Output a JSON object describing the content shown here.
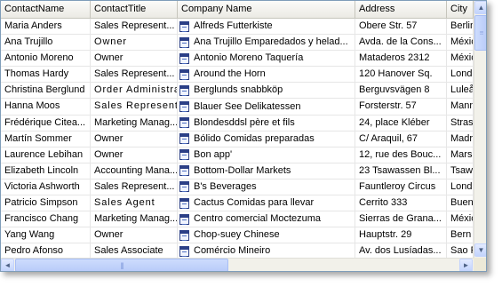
{
  "columns": [
    "ContactName",
    "ContactTitle",
    "Company Name",
    "Address",
    "City"
  ],
  "rows": [
    {
      "name": "Maria Anders",
      "title": "Sales Represent...",
      "company": "Alfreds Futterkiste",
      "address": "Obere Str. 57",
      "city": "Berlin"
    },
    {
      "name": "Ana Trujillo",
      "title": "Owner",
      "company": "Ana Trujillo Emparedados y helad...",
      "address": "Avda. de la Cons...",
      "city": "México"
    },
    {
      "name": "Antonio Moreno",
      "title": "Owner",
      "company": "Antonio Moreno Taquería",
      "address": "Mataderos 2312",
      "city": "México"
    },
    {
      "name": "Thomas Hardy",
      "title": "Sales Represent...",
      "company": "Around the Horn",
      "address": "120 Hanover Sq.",
      "city": "London"
    },
    {
      "name": "Christina Berglund",
      "title": "Order Administra...",
      "company": "Berglunds snabbköp",
      "address": "Berguvsvägen 8",
      "city": "Luleå"
    },
    {
      "name": "Hanna Moos",
      "title": "Sales Represent...",
      "company": "Blauer See Delikatessen",
      "address": "Forsterstr. 57",
      "city": "Mannheim"
    },
    {
      "name": "Frédérique Citea...",
      "title": "Marketing Manag...",
      "company": "Blondesddsl père et fils",
      "address": "24, place Kléber",
      "city": "Strasbourg"
    },
    {
      "name": "Martín Sommer",
      "title": "Owner",
      "company": "Bólido Comidas preparadas",
      "address": "C/ Araquil, 67",
      "city": "Madrid"
    },
    {
      "name": "Laurence Lebihan",
      "title": "Owner",
      "company": "Bon app'",
      "address": "12, rue des Bouc...",
      "city": "Marseille"
    },
    {
      "name": "Elizabeth Lincoln",
      "title": "Accounting Mana...",
      "company": "Bottom-Dollar Markets",
      "address": "23 Tsawassen Bl...",
      "city": "Tsawassen"
    },
    {
      "name": "Victoria Ashworth",
      "title": "Sales Represent...",
      "company": "B's Beverages",
      "address": "Fauntleroy Circus",
      "city": "London"
    },
    {
      "name": "Patricio Simpson",
      "title": "Sales Agent",
      "company": "Cactus Comidas para llevar",
      "address": "Cerrito 333",
      "city": "Buenos Aires"
    },
    {
      "name": "Francisco Chang",
      "title": "Marketing Manag...",
      "company": "Centro comercial Moctezuma",
      "address": "Sierras de Grana...",
      "city": "México"
    },
    {
      "name": "Yang Wang",
      "title": "Owner",
      "company": "Chop-suey Chinese",
      "address": "Hauptstr. 29",
      "city": "Bern"
    },
    {
      "name": "Pedro Afonso",
      "title": "Sales Associate",
      "company": "Comércio Mineiro",
      "address": "Av. dos Lusíadas...",
      "city": "Sao Paulo"
    }
  ],
  "scroll": {
    "up": "▲",
    "down": "▼",
    "left": "◄",
    "right": "►",
    "grip_v": "≡",
    "grip_h": "|||"
  },
  "icons": {
    "row_icon": "company-form-icon"
  }
}
